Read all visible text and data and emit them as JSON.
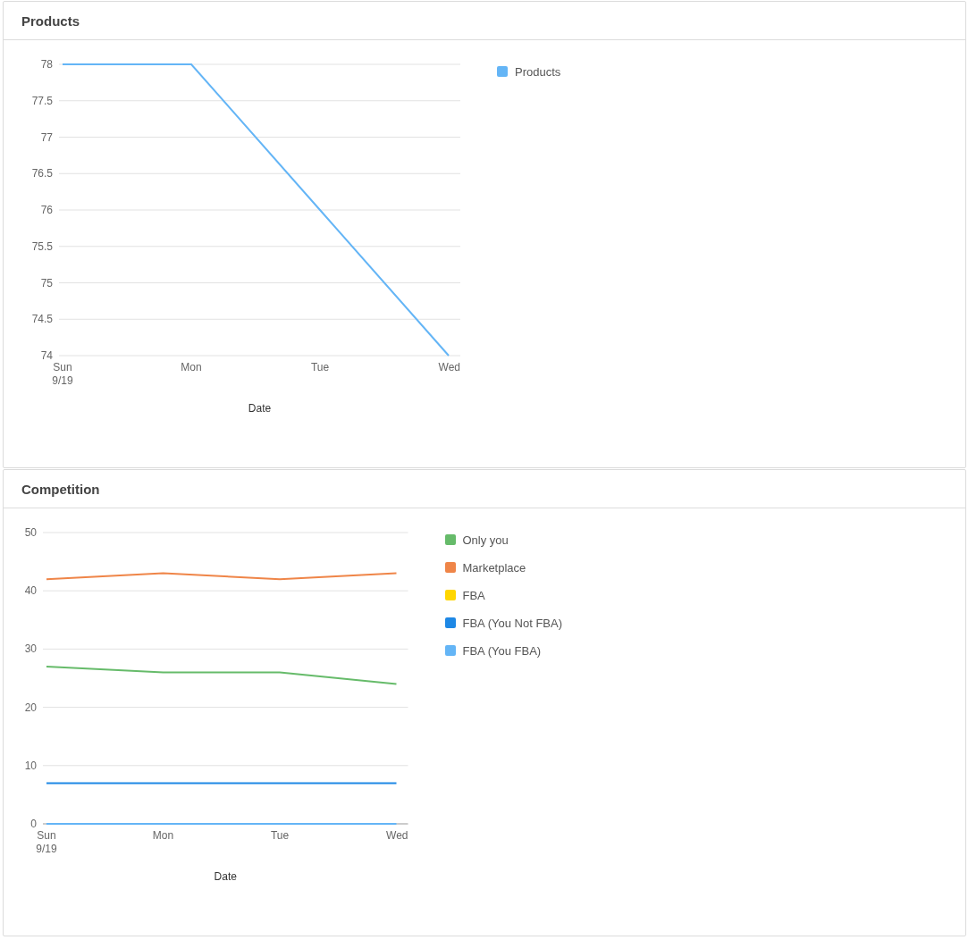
{
  "cards": [
    {
      "title": "Products",
      "chart_data": {
        "type": "line",
        "xlabel": "Date",
        "categories": [
          "Sun 9/19",
          "Mon",
          "Tue",
          "Wed"
        ],
        "grid": true,
        "ylim": [
          74,
          78
        ],
        "yticks": [
          74,
          74.5,
          75,
          75.5,
          76,
          76.5,
          77,
          77.5,
          78
        ],
        "series": [
          {
            "name": "Products",
            "color": "#64b5f6",
            "values": [
              78,
              78,
              76,
              74
            ]
          }
        ]
      }
    },
    {
      "title": "Competition",
      "chart_data": {
        "type": "line",
        "xlabel": "Date",
        "categories": [
          "Sun 9/19",
          "Mon",
          "Tue",
          "Wed"
        ],
        "grid": true,
        "ylim": [
          0,
          50
        ],
        "yticks": [
          0,
          10,
          20,
          30,
          40,
          50
        ],
        "series": [
          {
            "name": "Only you",
            "color": "#66bb6a",
            "values": [
              27,
              26,
              26,
              24
            ]
          },
          {
            "name": "Marketplace",
            "color": "#ef8548",
            "values": [
              42,
              43,
              42,
              43
            ]
          },
          {
            "name": "FBA",
            "color": "#ffd600",
            "values": [
              null,
              null,
              null,
              null
            ]
          },
          {
            "name": "FBA (You Not FBA)",
            "color": "#1e88e5",
            "values": [
              7,
              7,
              7,
              7
            ]
          },
          {
            "name": "FBA (You FBA)",
            "color": "#64b5f6",
            "values": [
              0,
              0,
              0,
              0
            ]
          }
        ]
      }
    }
  ]
}
